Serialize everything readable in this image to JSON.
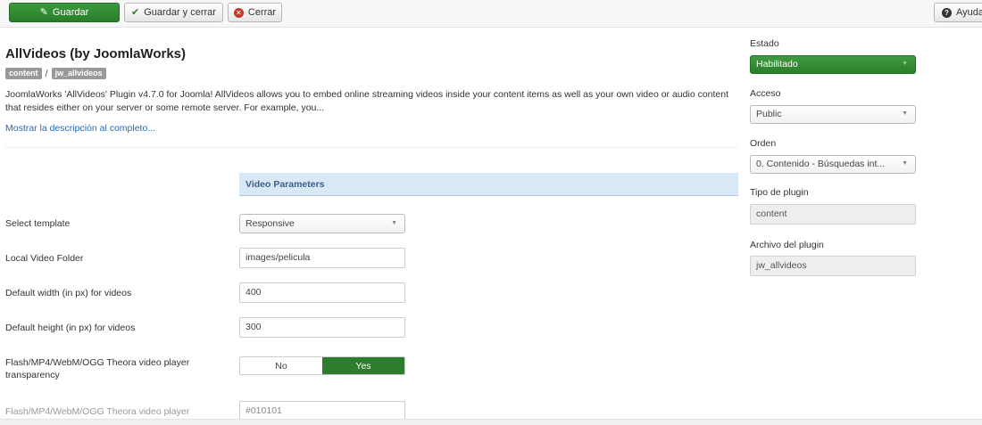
{
  "toolbar": {
    "save_label": "Guardar",
    "save_close_label": "Guardar y cerrar",
    "close_label": "Cerrar",
    "help_label": "Ayuda"
  },
  "header": {
    "title": "AllVideos (by JoomlaWorks)",
    "badge_group": "content",
    "badge_element": "jw_allvideos",
    "description": "JoomlaWorks 'AllVideos' Plugin v4.7.0 for Joomla! AllVideos allows you to embed online streaming videos inside your content items as well as your own video or audio content that resides either on your server or some remote server. For example, you...",
    "more_link": "Mostrar la descripción al completo..."
  },
  "section": {
    "title": "Video Parameters"
  },
  "fields": {
    "template": {
      "label": "Select template",
      "value": "Responsive"
    },
    "local_folder": {
      "label": "Local Video Folder",
      "value": "images/pelicula"
    },
    "width": {
      "label": "Default width (in px) for videos",
      "value": "400"
    },
    "height": {
      "label": "Default height (in px) for videos",
      "value": "300"
    },
    "transparency": {
      "label": "Flash/MP4/WebM/OGG Theora video player transparency",
      "no": "No",
      "yes": "Yes",
      "selected": "Yes"
    },
    "bgcolor": {
      "label": "Flash/MP4/WebM/OGG Theora video player",
      "value": "#010101"
    }
  },
  "sidebar": {
    "estado": {
      "label": "Estado",
      "value": "Habilitado"
    },
    "acceso": {
      "label": "Acceso",
      "value": "Public"
    },
    "orden": {
      "label": "Orden",
      "value": "0. Contenido - Búsquedas int..."
    },
    "tipo": {
      "label": "Tipo de plugin",
      "value": "content"
    },
    "archivo": {
      "label": "Archivo del plugin",
      "value": "jw_allvideos"
    }
  },
  "icons": {
    "save": "edit-square-icon",
    "save_close": "checkmark-icon",
    "close": "close-circle-icon",
    "help": "question-circle-icon",
    "dropdown": "chevron-down-icon"
  },
  "colors": {
    "primary_green": "#2e7d2e",
    "section_bg": "#d9e8f7",
    "link": "#2a69b8",
    "badge": "#999999"
  }
}
